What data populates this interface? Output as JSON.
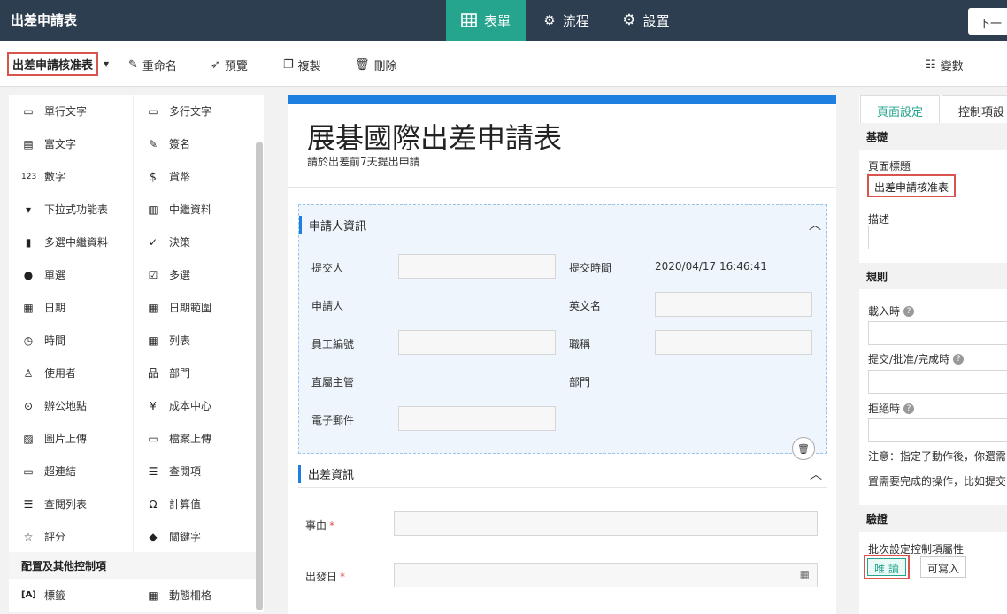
{
  "app": {
    "title": "出差申請表",
    "tabs": [
      {
        "label": "表單",
        "icon": "grid-icon"
      },
      {
        "label": "流程",
        "icon": "gears-icon"
      },
      {
        "label": "設置",
        "icon": "gear-icon"
      }
    ],
    "next_label": "下一"
  },
  "toolbar": {
    "form_name": "出差申請核准表",
    "rename_label": "重命名",
    "preview_label": "預覽",
    "copy_label": "複製",
    "delete_label": "刪除",
    "params_label": "變數"
  },
  "palette": {
    "items": [
      {
        "label": "單行文字",
        "icon": "text-line-icon",
        "glyph": "▭"
      },
      {
        "label": "多行文字",
        "icon": "text-area-icon",
        "glyph": "▭"
      },
      {
        "label": "富文字",
        "icon": "rich-text-icon",
        "glyph": "▤"
      },
      {
        "label": "簽名",
        "icon": "signature-icon",
        "glyph": "✎"
      },
      {
        "label": "數字",
        "icon": "number-icon",
        "glyph": "123"
      },
      {
        "label": "貨幣",
        "icon": "currency-icon",
        "glyph": "$"
      },
      {
        "label": "下拉式功能表",
        "icon": "dropdown-icon",
        "glyph": "▾"
      },
      {
        "label": "中繼資料",
        "icon": "metadata-icon",
        "glyph": "▥"
      },
      {
        "label": "多選中繼資料",
        "icon": "multi-metadata-icon",
        "glyph": "▮"
      },
      {
        "label": "決策",
        "icon": "decision-icon",
        "glyph": "✓"
      },
      {
        "label": "單選",
        "icon": "radio-icon",
        "glyph": "●"
      },
      {
        "label": "多選",
        "icon": "checkbox-icon",
        "glyph": "☑"
      },
      {
        "label": "日期",
        "icon": "date-icon",
        "glyph": "▦"
      },
      {
        "label": "日期範圍",
        "icon": "date-range-icon",
        "glyph": "▦"
      },
      {
        "label": "時間",
        "icon": "clock-icon",
        "glyph": "◷"
      },
      {
        "label": "列表",
        "icon": "table-icon",
        "glyph": "▦"
      },
      {
        "label": "使用者",
        "icon": "user-icon",
        "glyph": "♙"
      },
      {
        "label": "部門",
        "icon": "org-icon",
        "glyph": "品"
      },
      {
        "label": "辦公地點",
        "icon": "location-icon",
        "glyph": "⊙"
      },
      {
        "label": "成本中心",
        "icon": "cost-center-icon",
        "glyph": "¥"
      },
      {
        "label": "圖片上傳",
        "icon": "image-upload-icon",
        "glyph": "▨"
      },
      {
        "label": "檔案上傳",
        "icon": "file-upload-icon",
        "glyph": "▭"
      },
      {
        "label": "超連結",
        "icon": "link-icon",
        "glyph": "▭"
      },
      {
        "label": "查閱項",
        "icon": "lookup-icon",
        "glyph": "☰"
      },
      {
        "label": "查閱列表",
        "icon": "lookup-list-icon",
        "glyph": "☰"
      },
      {
        "label": "計算值",
        "icon": "omega-icon",
        "glyph": "Ω"
      },
      {
        "label": "評分",
        "icon": "star-icon",
        "glyph": "☆"
      },
      {
        "label": "關鍵字",
        "icon": "tag-icon",
        "glyph": "◆"
      }
    ],
    "section_title": "配置及其他控制項",
    "extra_items": [
      {
        "label": "標籤",
        "icon": "label-icon",
        "glyph": "[A]"
      },
      {
        "label": "動態柵格",
        "icon": "dynamic-grid-icon",
        "glyph": "▦"
      }
    ]
  },
  "form": {
    "title": "展碁國際出差申請表",
    "subtitle": "請於出差前7天提出申請",
    "section1": {
      "title": "申請人資訊",
      "fields": {
        "submitter": "提交人",
        "submit_time": "提交時間",
        "submit_time_value": "2020/04/17 16:46:41",
        "applicant": "申請人",
        "english_name": "英文名",
        "employee_id": "員工編號",
        "job_title": "職稱",
        "supervisor": "直屬主管",
        "department": "部門",
        "email": "電子郵件"
      }
    },
    "section2": {
      "title": "出差資訊",
      "reason_label": "事由",
      "departure_label": "出發日",
      "required_mark": "*"
    }
  },
  "right_panel": {
    "tabs": [
      "頁面設定",
      "控制項設"
    ],
    "basic_head": "基礎",
    "page_title_label": "頁面標題",
    "page_title_value": "出差申請核准表",
    "description_label": "描述",
    "rules_head": "規則",
    "on_load_label": "載入時",
    "on_submit_label": "提交/批准/完成時",
    "on_reject_label": "拒絕時",
    "note1": "注意：指定了動作後，你還需",
    "note2": "置需要完成的操作，比如提交",
    "validation_head": "驗證",
    "batch_label": "批次設定控制項屬性",
    "readonly_label": "唯 讀",
    "writable_label": "可寫入"
  }
}
